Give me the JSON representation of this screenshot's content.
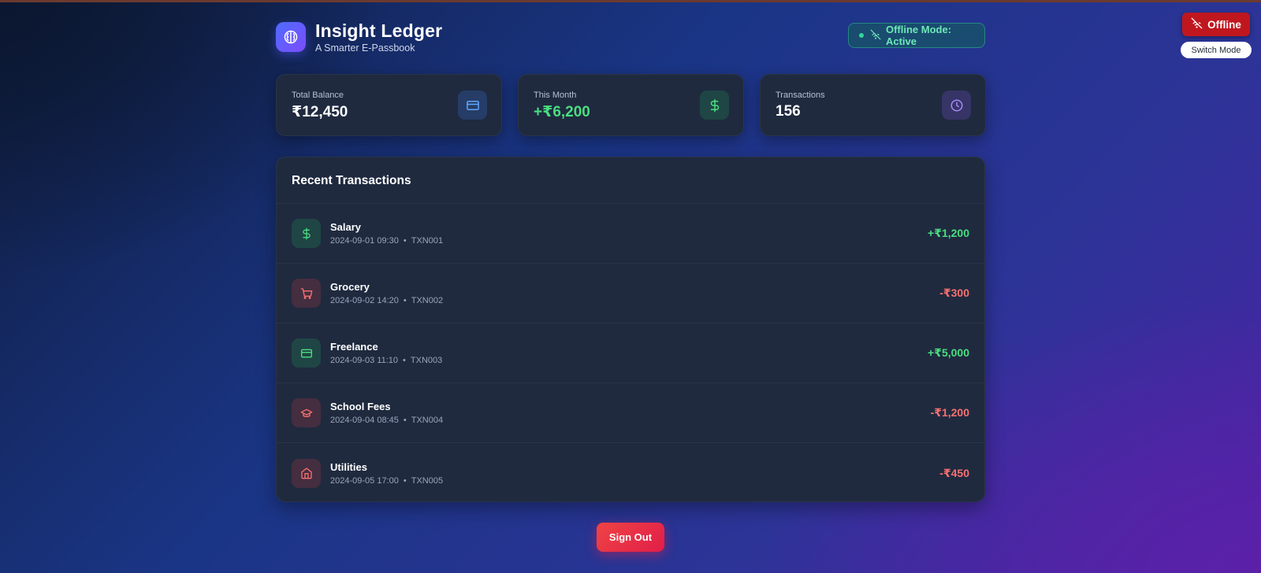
{
  "app": {
    "title": "Insight Ledger",
    "subtitle": "A Smarter E-Passbook"
  },
  "status": {
    "badge_label": "Offline Mode: Active",
    "offline_button": "Offline",
    "switch_mode_button": "Switch Mode"
  },
  "stats": [
    {
      "label": "Total Balance",
      "value": "₹12,450",
      "icon": "credit-card-icon",
      "accent": "#60a5fa"
    },
    {
      "label": "This Month",
      "value": "+₹6,200",
      "icon": "dollar-icon",
      "accent": "#4ade80"
    },
    {
      "label": "Transactions",
      "value": "156",
      "icon": "clock-icon",
      "accent": "#a78bfa"
    }
  ],
  "transactions": {
    "title": "Recent Transactions",
    "items": [
      {
        "name": "Salary",
        "datetime": "2024-09-01 09:30",
        "id": "TXN001",
        "amount": "+₹1,200",
        "type": "credit",
        "icon": "dollar-icon"
      },
      {
        "name": "Grocery",
        "datetime": "2024-09-02 14:20",
        "id": "TXN002",
        "amount": "-₹300",
        "type": "debit",
        "icon": "shopping-cart-icon"
      },
      {
        "name": "Freelance",
        "datetime": "2024-09-03 11:10",
        "id": "TXN003",
        "amount": "+₹5,000",
        "type": "credit",
        "icon": "credit-card-icon"
      },
      {
        "name": "School Fees",
        "datetime": "2024-09-04 08:45",
        "id": "TXN004",
        "amount": "-₹1,200",
        "type": "debit",
        "icon": "graduation-cap-icon"
      },
      {
        "name": "Utilities",
        "datetime": "2024-09-05 17:00",
        "id": "TXN005",
        "amount": "-₹450",
        "type": "debit",
        "icon": "home-icon"
      }
    ]
  },
  "actions": {
    "sign_out": "Sign Out"
  },
  "colors": {
    "credit": "#4ade80",
    "debit": "#f87171",
    "offline_button": "#c0171f",
    "badge_text": "#6ee7b7"
  }
}
